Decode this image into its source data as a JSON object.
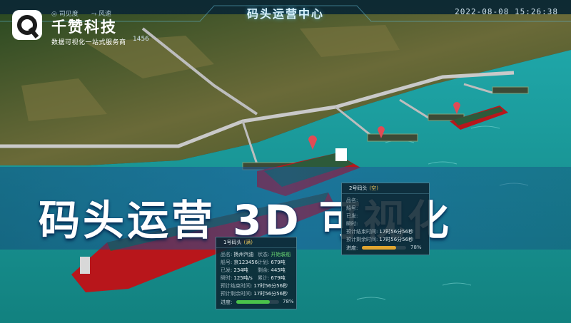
{
  "header": {
    "title": "码头运营中心",
    "datetime": "2022-08-08  15:26:38",
    "weather_left": "◎ 司见度",
    "weather_right": "⤳ 风速"
  },
  "brand": {
    "name": "千赞科技",
    "slogan": "数据可视化一站式服务商"
  },
  "code_number": "1456",
  "banner": {
    "title": "码头运营 3D 可视化"
  },
  "panel_berth1": {
    "header": "1号码头",
    "header_tag": "(满)",
    "rows": [
      {
        "k": "品名:",
        "v": "扬州汽油"
      },
      {
        "k": "状态:",
        "v": "开始装船"
      },
      {
        "k": "船号:",
        "v": "京123456"
      },
      {
        "k": "计划:",
        "v": "679吨"
      },
      {
        "k": "已发:",
        "v": "234吨"
      },
      {
        "k": "剩余:",
        "v": "445吨"
      },
      {
        "k": "瞬时:",
        "v": "125吨/s"
      },
      {
        "k": "累计:",
        "v": "679吨"
      },
      {
        "k": "预计结束时间:",
        "v": "17时56分56秒"
      },
      {
        "k": "预计剩余时间:",
        "v": "17时56分56秒"
      }
    ],
    "progress_label": "进度:",
    "progress_pct": 78,
    "progress_text": "78%"
  },
  "panel_berth2": {
    "header": "2号码头",
    "header_tag": "(空)",
    "rows": [
      {
        "k": "品名:",
        "v": ""
      },
      {
        "k": "船号:",
        "v": ""
      },
      {
        "k": "已发:",
        "v": ""
      },
      {
        "k": "瞬时:",
        "v": ""
      },
      {
        "k": "预计结束时间:",
        "v": "17时56分56秒"
      },
      {
        "k": "预计剩余时间:",
        "v": "17时56分56秒"
      }
    ],
    "progress_label": "进度:",
    "progress_pct": 78,
    "progress_text": "78%"
  },
  "colors": {
    "water": "#1a9aa0",
    "land": "#4a5a2a",
    "ship_hull": "#b8161b",
    "ship_deck": "#2d5a3a",
    "accent_green": "#4ac24a",
    "accent_orange": "#e0a530"
  }
}
